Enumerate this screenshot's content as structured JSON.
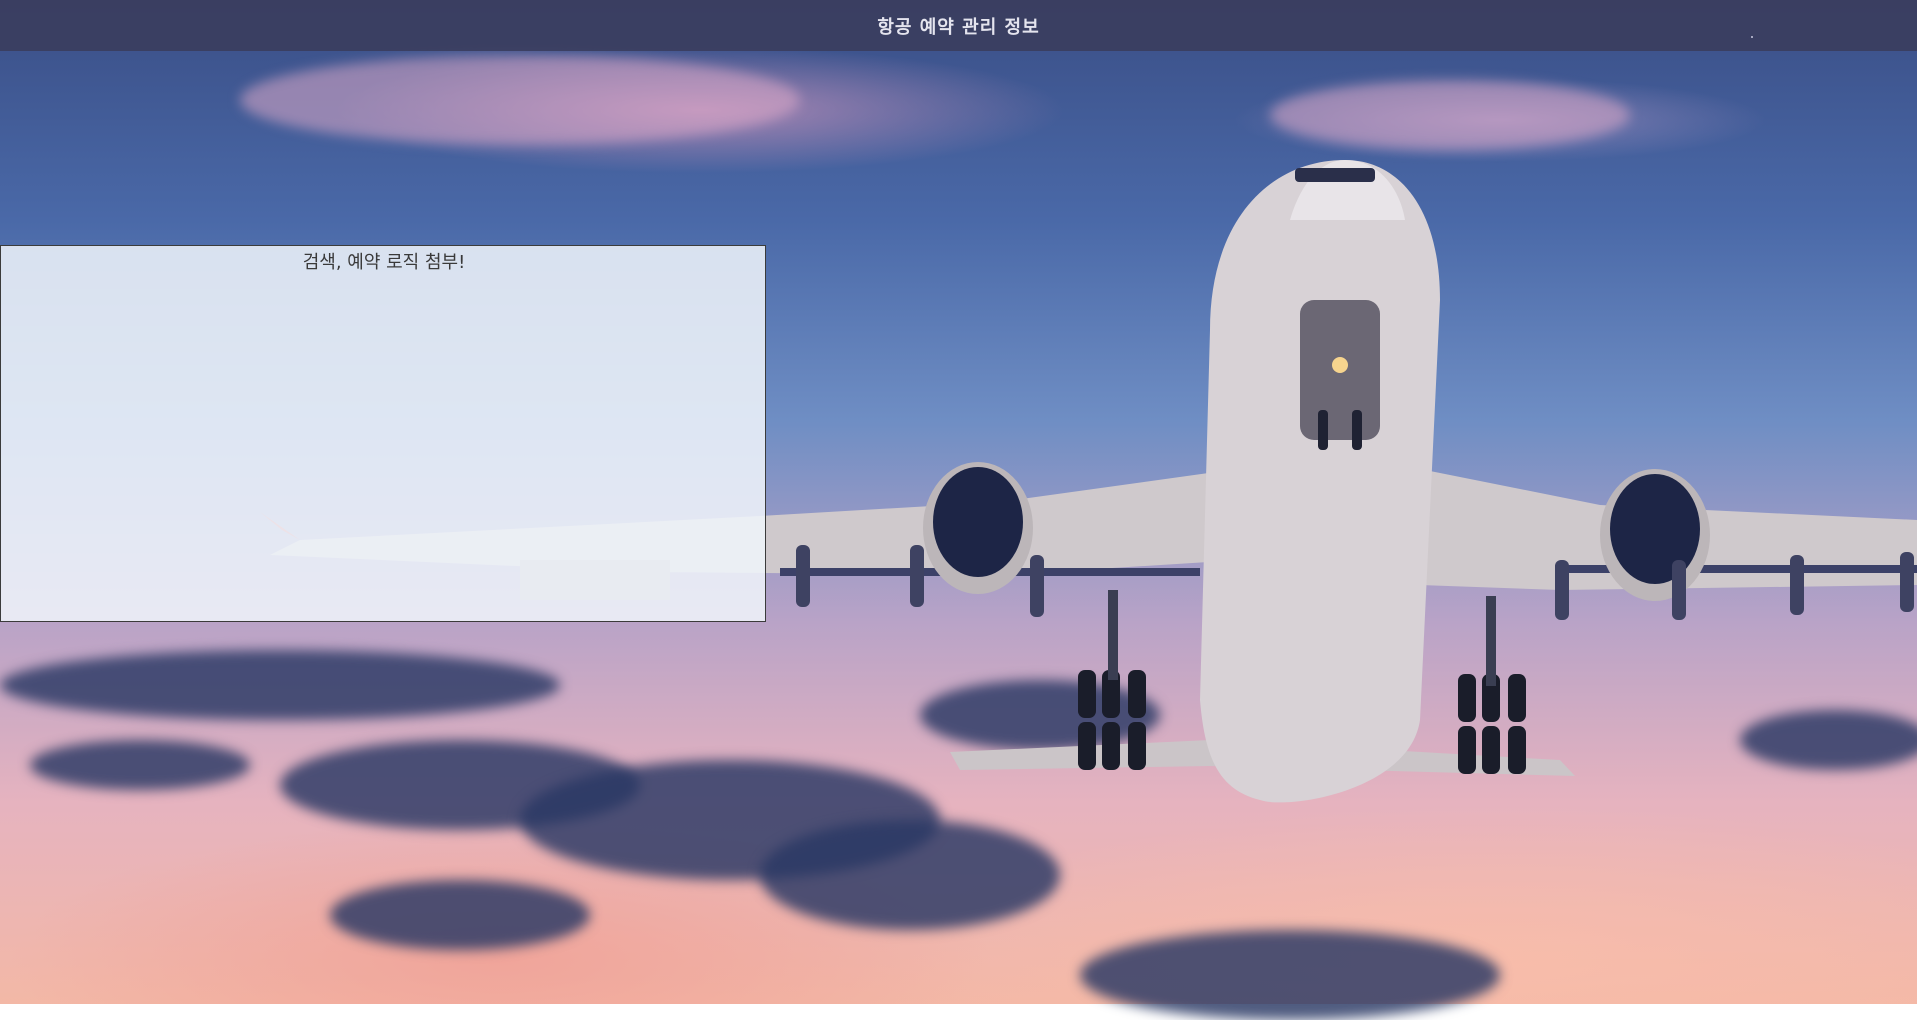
{
  "header": {
    "title": "항공 예약 관리 정보"
  },
  "panel": {
    "text": "검색, 예약 로직 첨부!"
  },
  "background": {
    "subject": "airplane-takeoff-sunset",
    "colors": {
      "sky_top": "#3a4e86",
      "sky_mid": "#6f8ec4",
      "sky_bottom": "#f3b8a6",
      "header_bg": "#3a3c5c",
      "panel_bg": "#f0f4fa"
    }
  }
}
